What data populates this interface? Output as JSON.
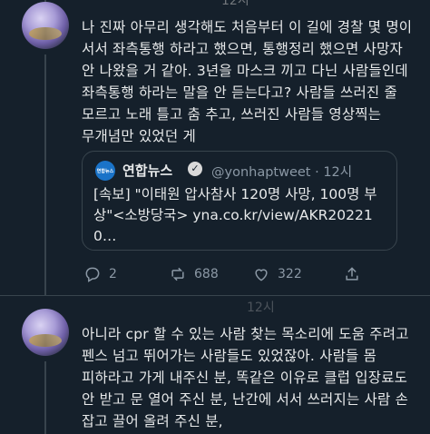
{
  "tweet1": {
    "time": "12시",
    "text": "나 진짜 아무리 생각해도 처음부터 이 길에 경찰 몇 명이 서서 좌측통행 하라고 했으면, 통행정리 했으면 사망자 안 나왔을 거 같아. 3년을 마스크 끼고 다닌 사람들인데 좌측통행 하라는 말을 안 듣는다고? 사람들 쓰러진 줄 모르고 노래 틀고 춤 추고, 쓰러진 사람들 영상찍는 무개념만 있었던 게",
    "quote": {
      "logo_text": "연합뉴스",
      "name": "연합뉴스",
      "handle": "@yonhaptweet · 12시",
      "text": "[속보] \"이태원 압사참사 120명 사망, 100명 부상\"<소방당국> yna.co.kr/view/AKR202210…"
    },
    "actions": {
      "replies": "2",
      "retweets": "688",
      "likes": "322"
    }
  },
  "tweet2": {
    "time": "12시",
    "text": "아니라 cpr 할 수 있는 사람 찾는 목소리에 도움 주려고 펜스 넘고 뛰어가는 사람들도 있었잖아. 사람들 몸 피하라고 가게 내주신 분, 똑같은 이유로 클럽 입장료도 안 받고 문 열어 주신 분, 난간에 서서 쓰러지는 사람 손 잡고 끌어 올려 주신 분,"
  }
}
